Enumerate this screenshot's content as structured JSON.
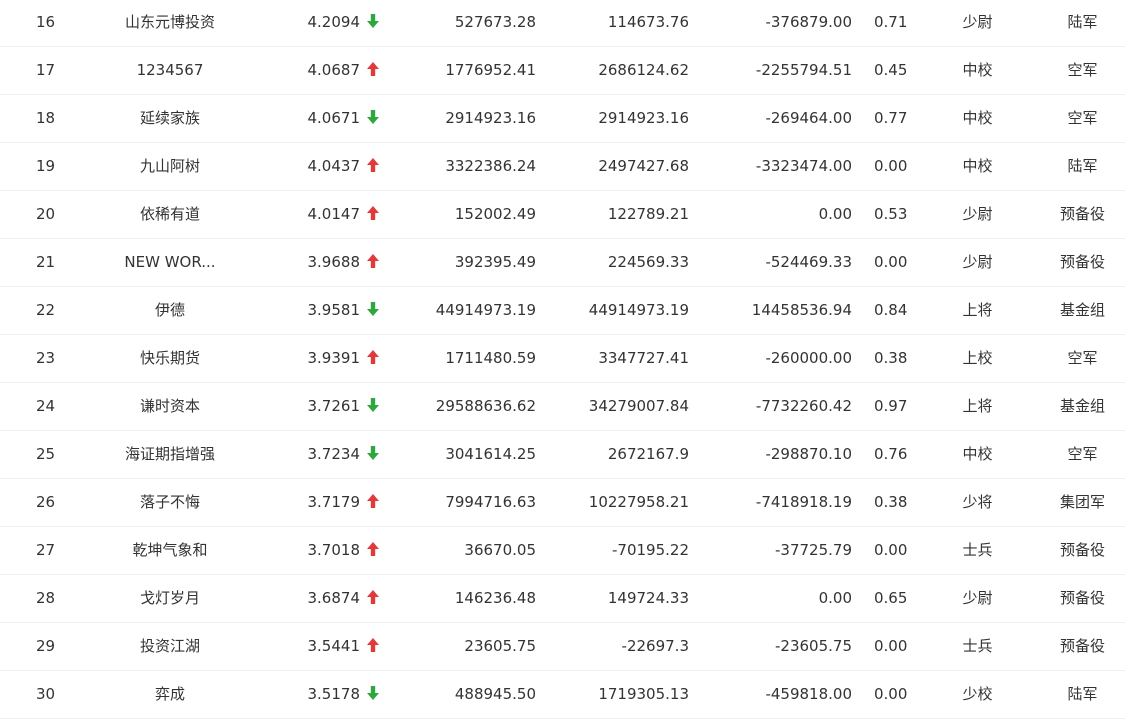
{
  "colors": {
    "up": "#e03a3a",
    "down": "#2ea83a"
  },
  "rows": [
    {
      "rank": "16",
      "name": "山东元博投资",
      "score": "4.2094",
      "trend": "down",
      "v1": "527673.28",
      "v2": "114673.76",
      "v3": "-376879.00",
      "ratio": "0.71",
      "title": "少尉",
      "unit": "陆军"
    },
    {
      "rank": "17",
      "name": "1234567",
      "score": "4.0687",
      "trend": "up",
      "v1": "1776952.41",
      "v2": "2686124.62",
      "v3": "-2255794.51",
      "ratio": "0.45",
      "title": "中校",
      "unit": "空军"
    },
    {
      "rank": "18",
      "name": "延续家族",
      "score": "4.0671",
      "trend": "down",
      "v1": "2914923.16",
      "v2": "2914923.16",
      "v3": "-269464.00",
      "ratio": "0.77",
      "title": "中校",
      "unit": "空军"
    },
    {
      "rank": "19",
      "name": "九山阿树",
      "score": "4.0437",
      "trend": "up",
      "v1": "3322386.24",
      "v2": "2497427.68",
      "v3": "-3323474.00",
      "ratio": "0.00",
      "title": "中校",
      "unit": "陆军"
    },
    {
      "rank": "20",
      "name": "依稀有道",
      "score": "4.0147",
      "trend": "up",
      "v1": "152002.49",
      "v2": "122789.21",
      "v3": "0.00",
      "ratio": "0.53",
      "title": "少尉",
      "unit": "预备役"
    },
    {
      "rank": "21",
      "name": "NEW WOR...",
      "score": "3.9688",
      "trend": "up",
      "v1": "392395.49",
      "v2": "224569.33",
      "v3": "-524469.33",
      "ratio": "0.00",
      "title": "少尉",
      "unit": "预备役"
    },
    {
      "rank": "22",
      "name": "伊德",
      "score": "3.9581",
      "trend": "down",
      "v1": "44914973.19",
      "v2": "44914973.19",
      "v3": "14458536.94",
      "ratio": "0.84",
      "title": "上将",
      "unit": "基金组"
    },
    {
      "rank": "23",
      "name": "快乐期货",
      "score": "3.9391",
      "trend": "up",
      "v1": "1711480.59",
      "v2": "3347727.41",
      "v3": "-260000.00",
      "ratio": "0.38",
      "title": "上校",
      "unit": "空军"
    },
    {
      "rank": "24",
      "name": "谦时资本",
      "score": "3.7261",
      "trend": "down",
      "v1": "29588636.62",
      "v2": "34279007.84",
      "v3": "-7732260.42",
      "ratio": "0.97",
      "title": "上将",
      "unit": "基金组"
    },
    {
      "rank": "25",
      "name": "海证期指增强",
      "score": "3.7234",
      "trend": "down",
      "v1": "3041614.25",
      "v2": "2672167.9",
      "v3": "-298870.10",
      "ratio": "0.76",
      "title": "中校",
      "unit": "空军"
    },
    {
      "rank": "26",
      "name": "落子不悔",
      "score": "3.7179",
      "trend": "up",
      "v1": "7994716.63",
      "v2": "10227958.21",
      "v3": "-7418918.19",
      "ratio": "0.38",
      "title": "少将",
      "unit": "集团军"
    },
    {
      "rank": "27",
      "name": "乾坤气象和",
      "score": "3.7018",
      "trend": "up",
      "v1": "36670.05",
      "v2": "-70195.22",
      "v3": "-37725.79",
      "ratio": "0.00",
      "title": "士兵",
      "unit": "预备役"
    },
    {
      "rank": "28",
      "name": "戈灯岁月",
      "score": "3.6874",
      "trend": "up",
      "v1": "146236.48",
      "v2": "149724.33",
      "v3": "0.00",
      "ratio": "0.65",
      "title": "少尉",
      "unit": "预备役"
    },
    {
      "rank": "29",
      "name": "投资江湖",
      "score": "3.5441",
      "trend": "up",
      "v1": "23605.75",
      "v2": "-22697.3",
      "v3": "-23605.75",
      "ratio": "0.00",
      "title": "士兵",
      "unit": "预备役"
    },
    {
      "rank": "30",
      "name": "弈成",
      "score": "3.5178",
      "trend": "down",
      "v1": "488945.50",
      "v2": "1719305.13",
      "v3": "-459818.00",
      "ratio": "0.00",
      "title": "少校",
      "unit": "陆军"
    }
  ]
}
